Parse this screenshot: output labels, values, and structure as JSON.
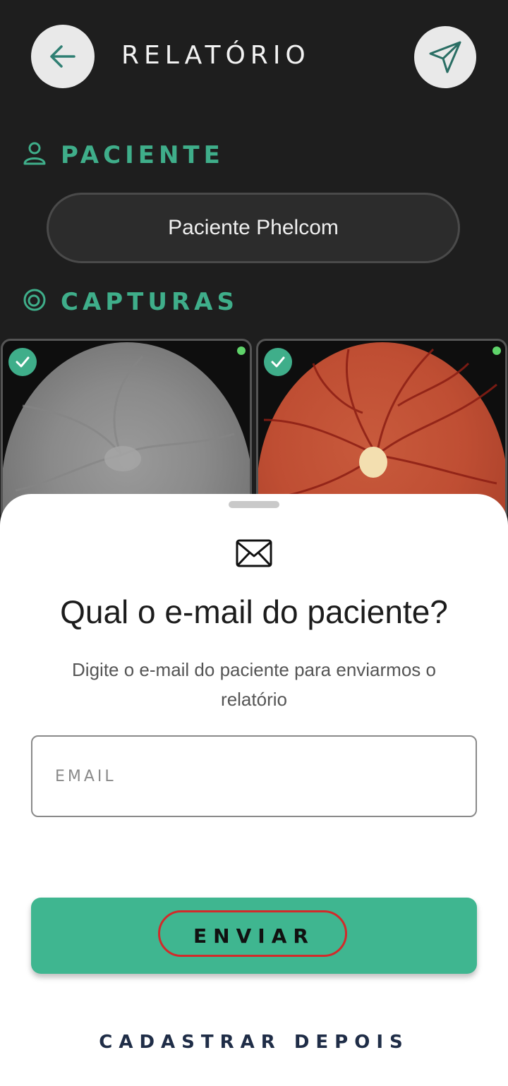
{
  "header": {
    "title": "RELATÓRIO",
    "back_icon": "arrow-left-icon",
    "send_icon": "paper-plane-icon"
  },
  "patient_section": {
    "label": "PACIENTE",
    "icon": "person-icon",
    "patient_name": "Paciente Phelcom"
  },
  "captures_section": {
    "label": "CAPTURAS",
    "icon": "eye-target-icon",
    "items": [
      {
        "kind": "red-free fundus image",
        "selected": true,
        "status": "green"
      },
      {
        "kind": "color fundus image",
        "selected": true,
        "status": "green"
      }
    ]
  },
  "email_sheet": {
    "icon": "envelope-icon",
    "title": "Qual o e-mail do paciente?",
    "subtitle": "Digite o e-mail do paciente para enviarmos o relatório",
    "email_placeholder": "EMAIL",
    "email_value": "",
    "send_label": "ENVIAR",
    "later_label": "CADASTRAR DEPOIS"
  },
  "colors": {
    "accent": "#3fb690",
    "background": "#1e1e1e",
    "highlight": "#d22a2a"
  }
}
